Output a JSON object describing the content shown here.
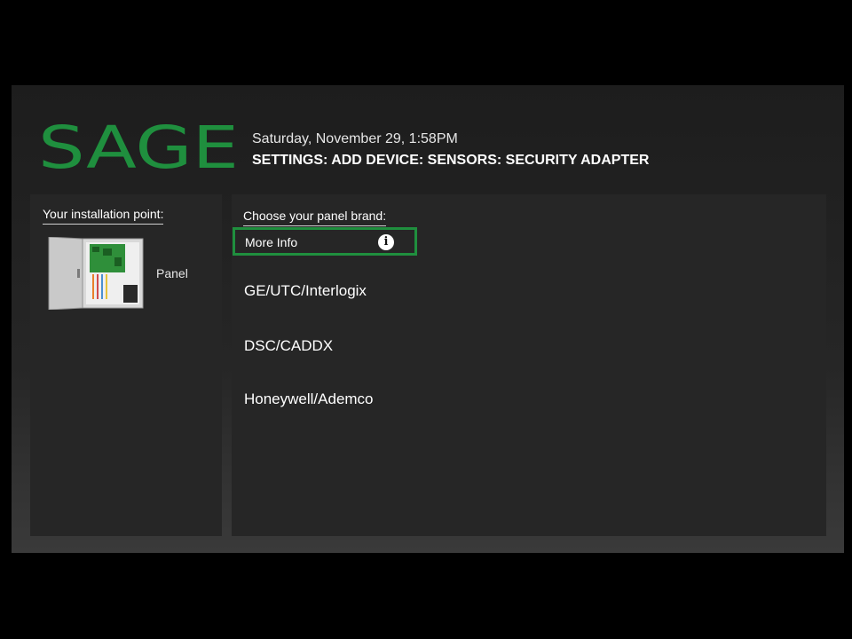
{
  "brand": {
    "logo_text": "SAGE",
    "logo_color": "#1f8f3e"
  },
  "header": {
    "datetime": "Saturday, November 29, 1:58PM",
    "breadcrumb": "SETTINGS: ADD DEVICE: SENSORS: SECURITY ADAPTER"
  },
  "installation": {
    "heading": "Your installation point:",
    "device_label": "Panel",
    "device_icon": "control-panel-icon"
  },
  "panel_brand": {
    "heading": "Choose your panel brand:",
    "more_info_label": "More Info",
    "info_icon_glyph": "i",
    "options": [
      {
        "label": "GE/UTC/Interlogix"
      },
      {
        "label": "DSC/CADDX"
      },
      {
        "label": "Honeywell/Ademco"
      }
    ]
  },
  "colors": {
    "accent": "#1f8f3e",
    "background": "#000000",
    "panel": "#262626"
  }
}
